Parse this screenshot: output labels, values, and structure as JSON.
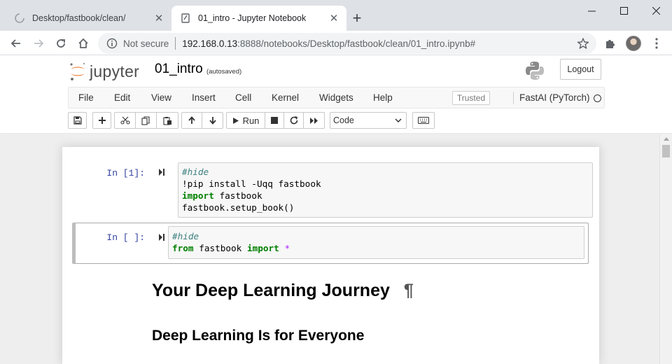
{
  "browser": {
    "tabs": [
      {
        "title": "Desktop/fastbook/clean/",
        "active": false
      },
      {
        "title": "01_intro - Jupyter Notebook",
        "active": true
      }
    ],
    "address_bar": {
      "security_label": "Not secure",
      "url_host": "192.168.0.13",
      "url_rest": ":8888/notebooks/Desktop/fastbook/clean/01_intro.ipynb#"
    }
  },
  "jupyter": {
    "logo_text": "jupyter",
    "notebook_name": "01_intro",
    "autosave_status": "(autosaved)",
    "logout_label": "Logout",
    "menu": [
      "File",
      "Edit",
      "View",
      "Insert",
      "Cell",
      "Kernel",
      "Widgets",
      "Help"
    ],
    "trusted_label": "Trusted",
    "kernel_name": "FastAI (PyTorch)",
    "toolbar": {
      "run_label": "Run",
      "cell_type": "Code"
    }
  },
  "notebook": {
    "cells": [
      {
        "prompt": "In [1]:",
        "lines": [
          "#hide",
          "!pip install -Uqq fastbook",
          "import fastbook",
          "fastbook.setup_book()"
        ]
      },
      {
        "prompt": "In [ ]:",
        "lines": [
          "#hide",
          "from fastbook import *"
        ]
      }
    ],
    "heading1": "Your Deep Learning Journey",
    "heading1_anchor": "¶",
    "heading2": "Deep Learning Is for Everyone"
  },
  "colors": {
    "prompt": "#303f9f",
    "comment": "#408080",
    "keyword": "#008000",
    "operator": "#aa22ff",
    "jupyter_orange": "#f37726"
  },
  "icons": [
    "chrome-loading-icon",
    "notebook-favicon",
    "tab-close-icon",
    "new-tab-icon",
    "back-arrow-icon",
    "forward-arrow-icon",
    "reload-icon",
    "home-icon",
    "info-icon",
    "bookmark-star-icon",
    "extensions-icon",
    "profile-avatar",
    "kebab-menu-icon",
    "python-logo-icon",
    "save-icon",
    "plus-icon",
    "cut-icon",
    "copy-icon",
    "paste-icon",
    "arrow-up-icon",
    "arrow-down-icon",
    "run-icon",
    "stop-icon",
    "restart-icon",
    "fast-forward-icon",
    "keyboard-icon"
  ]
}
